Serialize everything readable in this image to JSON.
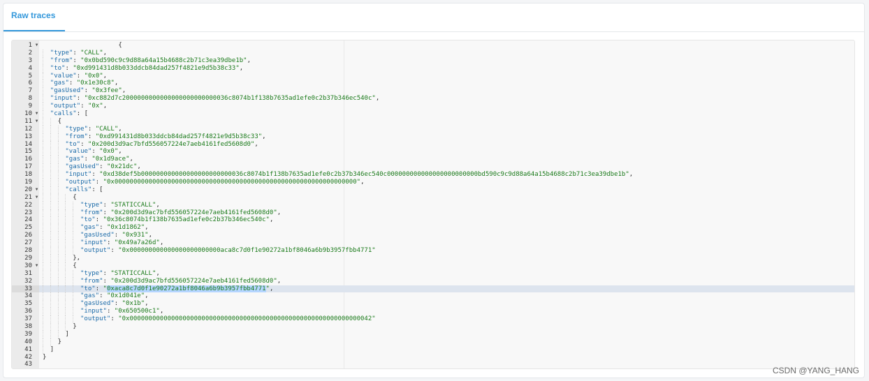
{
  "tab": {
    "label": "Raw traces"
  },
  "watermark": "CSDN @YANG_HANG",
  "editor": {
    "active_line": 33,
    "selected_text": "0xaca8c7d0f1e90272a1bf8046a6b9b3957fbb4771",
    "lines": [
      {
        "n": "1",
        "fold": true,
        "indent": 0,
        "text": "                    {"
      },
      {
        "n": "2",
        "fold": false,
        "indent": 1,
        "key": "\"type\"",
        "value": "\"CALL\"",
        "tail": ","
      },
      {
        "n": "3",
        "fold": false,
        "indent": 1,
        "key": "\"from\"",
        "value": "\"0x0bd590c9c9d88a64a15b4688c2b71c3ea39dbe1b\"",
        "tail": ","
      },
      {
        "n": "4",
        "fold": false,
        "indent": 1,
        "key": "\"to\"",
        "value": "\"0xd991431d8b033ddcb84dad257f4821e9d5b38c33\"",
        "tail": ","
      },
      {
        "n": "5",
        "fold": false,
        "indent": 1,
        "key": "\"value\"",
        "value": "\"0x0\"",
        "tail": ","
      },
      {
        "n": "6",
        "fold": false,
        "indent": 1,
        "key": "\"gas\"",
        "value": "\"0x1e30c8\"",
        "tail": ","
      },
      {
        "n": "7",
        "fold": false,
        "indent": 1,
        "key": "\"gasUsed\"",
        "value": "\"0x3fee\"",
        "tail": ","
      },
      {
        "n": "8",
        "fold": false,
        "indent": 1,
        "key": "\"input\"",
        "value": "\"0xc882d7c2000000000000000000000000036c8074b1f138b7635ad1efe0c2b37b346ec540c\"",
        "tail": ","
      },
      {
        "n": "9",
        "fold": false,
        "indent": 1,
        "key": "\"output\"",
        "value": "\"0x\"",
        "tail": ","
      },
      {
        "n": "10",
        "fold": true,
        "indent": 1,
        "key": "\"calls\"",
        "tail": " ["
      },
      {
        "n": "11",
        "fold": true,
        "indent": 2,
        "text": "{"
      },
      {
        "n": "12",
        "fold": false,
        "indent": 3,
        "key": "\"type\"",
        "value": "\"CALL\"",
        "tail": ","
      },
      {
        "n": "13",
        "fold": false,
        "indent": 3,
        "key": "\"from\"",
        "value": "\"0xd991431d8b033ddcb84dad257f4821e9d5b38c33\"",
        "tail": ","
      },
      {
        "n": "14",
        "fold": false,
        "indent": 3,
        "key": "\"to\"",
        "value": "\"0x200d3d9ac7bfd556057224e7aeb4161fed5608d0\"",
        "tail": ","
      },
      {
        "n": "15",
        "fold": false,
        "indent": 3,
        "key": "\"value\"",
        "value": "\"0x0\"",
        "tail": ","
      },
      {
        "n": "16",
        "fold": false,
        "indent": 3,
        "key": "\"gas\"",
        "value": "\"0x1d9ace\"",
        "tail": ","
      },
      {
        "n": "17",
        "fold": false,
        "indent": 3,
        "key": "\"gasUsed\"",
        "value": "\"0x21dc\"",
        "tail": ","
      },
      {
        "n": "18",
        "fold": false,
        "indent": 3,
        "key": "\"input\"",
        "value": "\"0xd38def5b000000000000000000000000036c8074b1f138b7635ad1efe0c2b37b346ec540c000000000000000000000000bd590c9c9d88a64a15b4688c2b71c3ea39dbe1b\"",
        "tail": ","
      },
      {
        "n": "19",
        "fold": false,
        "indent": 3,
        "key": "\"output\"",
        "value": "\"0x0000000000000000000000000000000000000000000000000000000000000000\"",
        "tail": ","
      },
      {
        "n": "20",
        "fold": true,
        "indent": 3,
        "key": "\"calls\"",
        "tail": " ["
      },
      {
        "n": "21",
        "fold": true,
        "indent": 4,
        "text": "{"
      },
      {
        "n": "22",
        "fold": false,
        "indent": 5,
        "key": "\"type\"",
        "value": "\"STATICCALL\"",
        "tail": ","
      },
      {
        "n": "23",
        "fold": false,
        "indent": 5,
        "key": "\"from\"",
        "value": "\"0x200d3d9ac7bfd556057224e7aeb4161fed5608d0\"",
        "tail": ","
      },
      {
        "n": "24",
        "fold": false,
        "indent": 5,
        "key": "\"to\"",
        "value": "\"0x36c8074b1f138b7635ad1efe0c2b37b346ec540c\"",
        "tail": ","
      },
      {
        "n": "25",
        "fold": false,
        "indent": 5,
        "key": "\"gas\"",
        "value": "\"0x1d1862\"",
        "tail": ","
      },
      {
        "n": "26",
        "fold": false,
        "indent": 5,
        "key": "\"gasUsed\"",
        "value": "\"0x931\"",
        "tail": ","
      },
      {
        "n": "27",
        "fold": false,
        "indent": 5,
        "key": "\"input\"",
        "value": "\"0x49a7a26d\"",
        "tail": ","
      },
      {
        "n": "28",
        "fold": false,
        "indent": 5,
        "key": "\"output\"",
        "value": "\"0x000000000000000000000000aca8c7d0f1e90272a1bf8046a6b9b3957fbb4771\"",
        "tail": ""
      },
      {
        "n": "29",
        "fold": false,
        "indent": 4,
        "text": "},"
      },
      {
        "n": "30",
        "fold": true,
        "indent": 4,
        "text": "{"
      },
      {
        "n": "31",
        "fold": false,
        "indent": 5,
        "key": "\"type\"",
        "value": "\"STATICCALL\"",
        "tail": ","
      },
      {
        "n": "32",
        "fold": false,
        "indent": 5,
        "key": "\"from\"",
        "value": "\"0x200d3d9ac7bfd556057224e7aeb4161fed5608d0\"",
        "tail": ","
      },
      {
        "n": "33",
        "fold": false,
        "indent": 5,
        "key": "\"to\"",
        "value": "\"0xaca8c7d0f1e90272a1bf8046a6b9b3957fbb4771\"",
        "tail": ",",
        "selected": true
      },
      {
        "n": "34",
        "fold": false,
        "indent": 5,
        "key": "\"gas\"",
        "value": "\"0x1d041e\"",
        "tail": ","
      },
      {
        "n": "35",
        "fold": false,
        "indent": 5,
        "key": "\"gasUsed\"",
        "value": "\"0x1b\"",
        "tail": ","
      },
      {
        "n": "36",
        "fold": false,
        "indent": 5,
        "key": "\"input\"",
        "value": "\"0x650500c1\"",
        "tail": ","
      },
      {
        "n": "37",
        "fold": false,
        "indent": 5,
        "key": "\"output\"",
        "value": "\"0x0000000000000000000000000000000000000000000000000000000000000042\"",
        "tail": ""
      },
      {
        "n": "38",
        "fold": false,
        "indent": 4,
        "text": "}"
      },
      {
        "n": "39",
        "fold": false,
        "indent": 3,
        "text": "]"
      },
      {
        "n": "40",
        "fold": false,
        "indent": 2,
        "text": "}"
      },
      {
        "n": "41",
        "fold": false,
        "indent": 1,
        "text": "]"
      },
      {
        "n": "42",
        "fold": false,
        "indent": 0,
        "text": "}"
      },
      {
        "n": "43",
        "fold": false,
        "indent": 0,
        "text": ""
      }
    ]
  }
}
